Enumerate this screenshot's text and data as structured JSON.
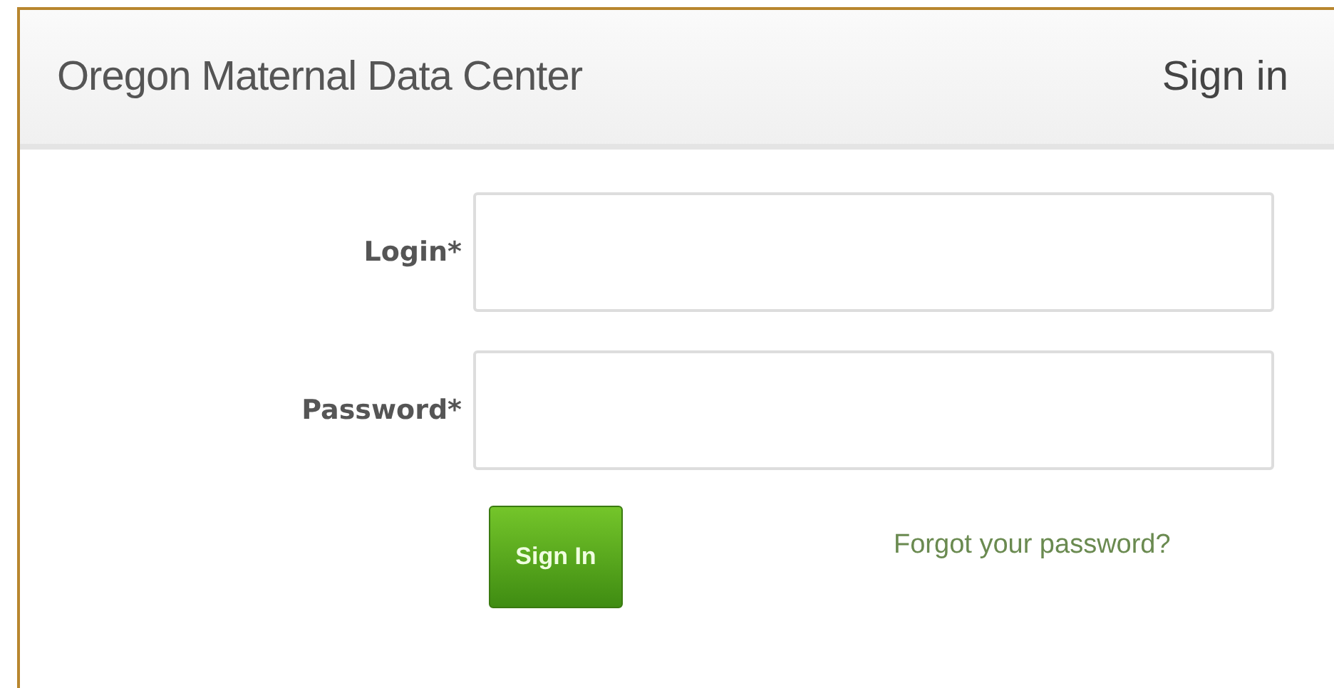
{
  "header": {
    "title": "Oregon Maternal Data Center",
    "action": "Sign in"
  },
  "fields": [
    {
      "label": "Login*"
    },
    {
      "label": "Password*"
    }
  ],
  "submit": {
    "label": "Sign In"
  },
  "forgot_link": "Forgot your password?"
}
